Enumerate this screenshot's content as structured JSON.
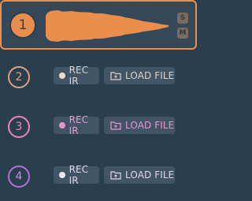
{
  "slots": [
    {
      "number": "1",
      "active": true,
      "solo_label": "S",
      "mute_label": "M",
      "color": "#e98e4d"
    },
    {
      "number": "2",
      "rec_label": "REC IR",
      "load_label": "LOAD FILE",
      "color": "#e0a081",
      "text_color": "#d9d2cb"
    },
    {
      "number": "3",
      "rec_label": "REC IR",
      "load_label": "LOAD FILE",
      "color": "#e884c4",
      "text_color": "#ec94cd"
    },
    {
      "number": "4",
      "rec_label": "REC IR",
      "load_label": "LOAD FILE",
      "color": "#b072d8",
      "text_color": "#dcd8e8"
    }
  ]
}
